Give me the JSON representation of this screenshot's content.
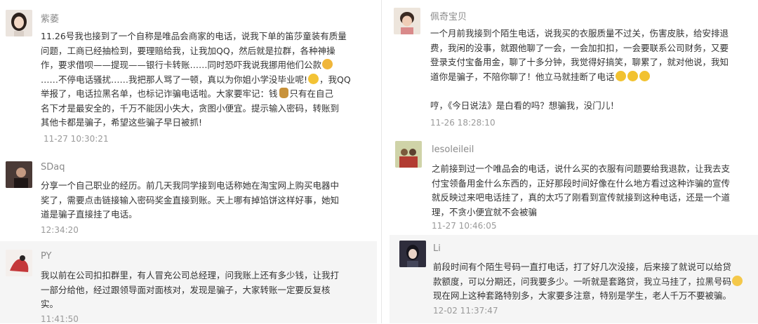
{
  "left": [
    {
      "name": "紫萎",
      "lines": [
        "11.26号我也接到了一个自称是唯品会商家的电话，说我下单的笛莎童装有质量",
        "问题，工商已经抽检到，要理赔给我，让我加QQ，然后就是拉群，各种神操",
        "作，要求借呗——提现——银行卡转账……同时恐吓我说我挪用他们公款",
        "……不停电话骚扰……我把那人骂了一顿，真以为你姐小学没毕业呢!",
        "举报了，电话拉黑名单，也标记诈骗电话啦。大家要牢记：钱",
        "名下才是最安全的，千万不能因小失大，贪图小便宜。提示输入密码，转账到",
        "其他卡都是骗子，希望这些骗子早日被抓!"
      ],
      "line4_tail": "，我QQ",
      "line5_tail": "只有在自己",
      "time": "11-27 10:30:21"
    },
    {
      "name": "SDaq",
      "lines": [
        "分享一个自己职业的经历。前几天我同学接到电话称她在淘宝网上购买电器中",
        "奖了，需要点击链接输入密码奖金直接到账。天上哪有掉馅饼这样好事，她知",
        "道是骗子直接挂了电话。"
      ],
      "time": "12:34:20"
    },
    {
      "name": "PY",
      "lines": [
        "我以前在公司扣扣群里，有人冒充公司总经理，问我账上还有多少钱，让我打",
        "一部分给他，经过跟领导面对面核对，发现是骗子，大家转账一定要反复核",
        "实。"
      ],
      "time": "11:41:50"
    }
  ],
  "right": [
    {
      "name": "佩奇宝贝",
      "lines": [
        "一个月前我接到个陌生电话，说我买的衣服质量不过关，伤害皮肤，给安排退",
        "费，我闲的没事，就跟他聊了一会，一会加扣扣，一会要联系公司财务，又要",
        "登录支付宝备用金，聊了十多分钟，我觉得好搞笑，聊累了，就对他说，我知",
        "道你是骗子，不陪你聊了！他立马就挂断了电话",
        "",
        "哼，《今日说法》是白看的吗？想骗我，没门儿！"
      ],
      "time": "11-26 18:28:10"
    },
    {
      "name": "lesoleileil",
      "lines": [
        "之前接到过一个唯品会的电话，说什么买的衣服有问题要给我退款，让我去支",
        "付宝领备用金什么东西的，正好那段时间好像在什么地方看过这种诈骗的宣传",
        "就反映过来吧电话挂了，真的太巧了刚看到宣传就接到这种电话，还是一个道",
        "理，不贪小便宜就不会被骗"
      ],
      "time": "11-27 10:46:05"
    },
    {
      "name": "Li",
      "lines": [
        "前段时间有个陌生号码一直打电话，打了好几次没接，后来接了就说可以给贷",
        "款额度，可以分期还，问我要多少。一听就是套路贷，我立马挂了，拉黑号码",
        "现在网上这种套路特别多，大家要多注意，特别是学生，老人千万不要被骗。"
      ],
      "time": "12-02 11:37:47"
    }
  ]
}
